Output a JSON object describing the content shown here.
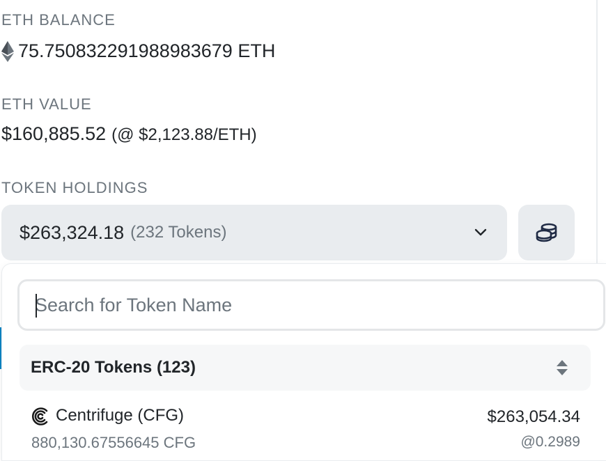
{
  "eth_balance": {
    "label": "ETH BALANCE",
    "value": "75.750832291988983679 ETH",
    "icon": "ethereum-icon"
  },
  "eth_value": {
    "label": "ETH VALUE",
    "usd": "$160,885.52",
    "price": "(@ $2,123.88/ETH)"
  },
  "token_holdings": {
    "label": "TOKEN HOLDINGS",
    "total": "$263,324.18",
    "count": "(232 Tokens)",
    "dropdown_icon": "chevron-down-icon",
    "coins_icon": "coins-icon"
  },
  "token_dropdown": {
    "search_placeholder": "Search for Token Name",
    "search_value": "",
    "group": {
      "label": "ERC-20 Tokens (123)",
      "sort_icon": "sort-icon"
    },
    "tokens": [
      {
        "name": "Centrifuge (CFG)",
        "amount": "880,130.67556645 CFG",
        "value": "$263,054.34",
        "rate": "@0.2989",
        "icon": "centrifuge-icon"
      }
    ]
  },
  "colors": {
    "label_gray": "#6c757d",
    "text_dark": "#212529",
    "select_bg": "#e9ecef",
    "accent_blue": "#0784c3"
  }
}
